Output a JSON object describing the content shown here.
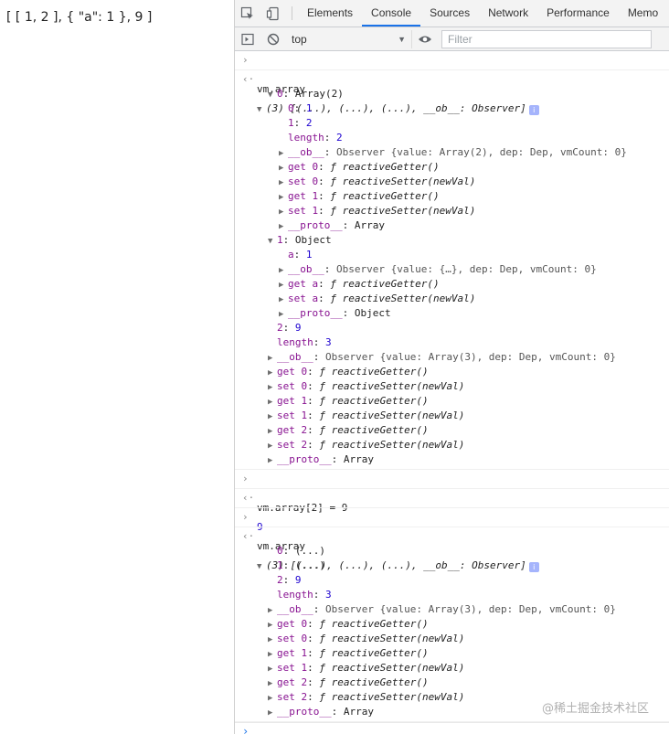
{
  "page": {
    "output_text": "[ [ 1, 2 ], { \"a\": 1 }, 9 ]"
  },
  "devtools": {
    "tabs": [
      "Elements",
      "Console",
      "Sources",
      "Network",
      "Performance",
      "Memo"
    ],
    "active_tab": "Console",
    "toolbar": {
      "context": "top",
      "filter_placeholder": "Filter"
    }
  },
  "console": {
    "cmd1": "vm.array",
    "cmd2": "vm.array[2] = 9",
    "cmd2_result": "9",
    "cmd3": "vm.array",
    "root_summary": "(3) [(...), (...), (...), __ob__: Observer]",
    "t": {
      "k0": "0",
      "k1": "1",
      "k2": "2",
      "klen": "length",
      "arr2": "Array(2)",
      "obj": "Object",
      "arr": "Array",
      "ob": "__ob__",
      "proto": "__proto__",
      "observer_arr2": "Observer {value: Array(2), dep: Dep, vmCount: 0}",
      "observer_obj": "Observer {value: {…}, dep: Dep, vmCount: 0}",
      "observer_arr3": "Observer {value: Array(3), dep: Dep, vmCount: 0}",
      "getter": "ƒ reactiveGetter()",
      "setter": "ƒ reactiveSetter(newVal)",
      "get0": "get 0",
      "set0": "set 0",
      "get1": "get 1",
      "set1": "set 1",
      "get2": "get 2",
      "set2": "set 2",
      "geta": "get a",
      "seta": "set a",
      "ka": "a",
      "v1": "1",
      "v2": "2",
      "v3": "3",
      "v9": "9",
      "ellipsis": "(...)"
    }
  },
  "watermark": "@稀土掘金技术社区"
}
